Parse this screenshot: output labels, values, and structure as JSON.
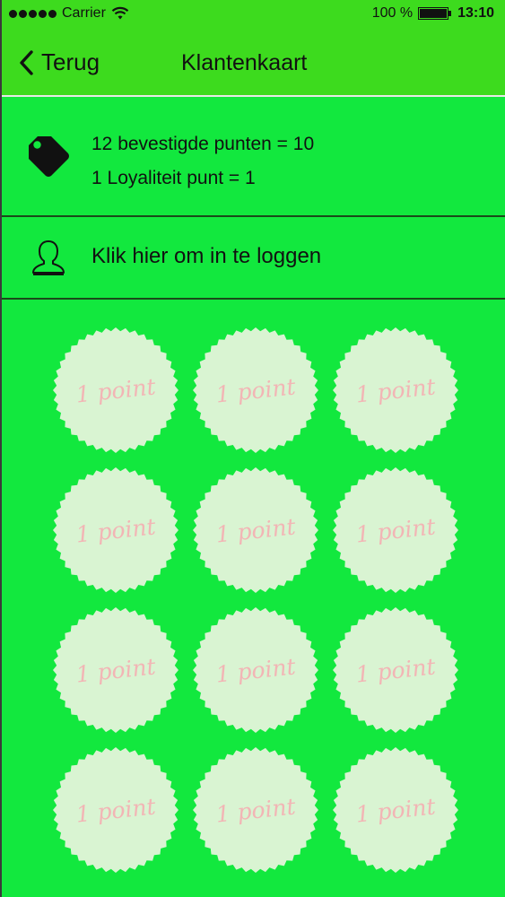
{
  "status_bar": {
    "carrier": "Carrier",
    "battery": "100 %",
    "time": "13:10"
  },
  "nav": {
    "back_label": "Terug",
    "title": "Klantenkaart"
  },
  "points": {
    "line1": "12 bevestigde punten = 10",
    "line2": "1 Loyaliteit punt = 1"
  },
  "login": {
    "label": "Klik hier om in te loggen"
  },
  "stamps": {
    "label": "1 point",
    "count": 12
  },
  "colors": {
    "background": "#12e83e",
    "bar": "#3ddb1e",
    "stamp_fill": "#d9f4d2",
    "stamp_text": "#f2b5b5"
  },
  "icons": {
    "back": "chevron-left-icon",
    "points": "tag-icon",
    "login": "user-icon",
    "wifi": "wifi-icon",
    "battery": "battery-icon"
  }
}
